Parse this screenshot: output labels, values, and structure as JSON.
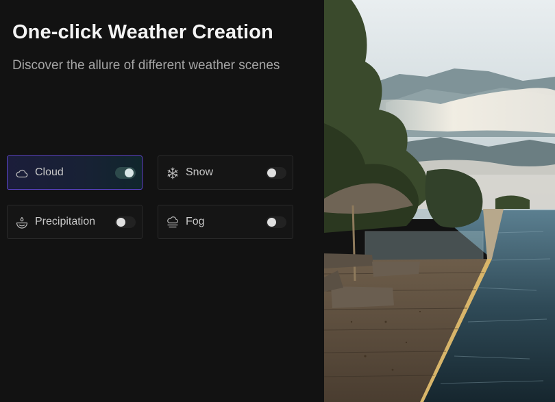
{
  "header": {
    "title": "One-click Weather Creation",
    "subtitle": "Discover the allure of different weather scenes"
  },
  "weather_options": [
    {
      "label": "Cloud",
      "icon": "cloud-icon",
      "enabled": true
    },
    {
      "label": "Snow",
      "icon": "snowflake-icon",
      "enabled": false
    },
    {
      "label": "Precipitation",
      "icon": "precipitation-icon",
      "enabled": false
    },
    {
      "label": "Fog",
      "icon": "fog-icon",
      "enabled": false
    }
  ],
  "colors": {
    "background": "#121212",
    "active_border": "#5b45c9"
  }
}
